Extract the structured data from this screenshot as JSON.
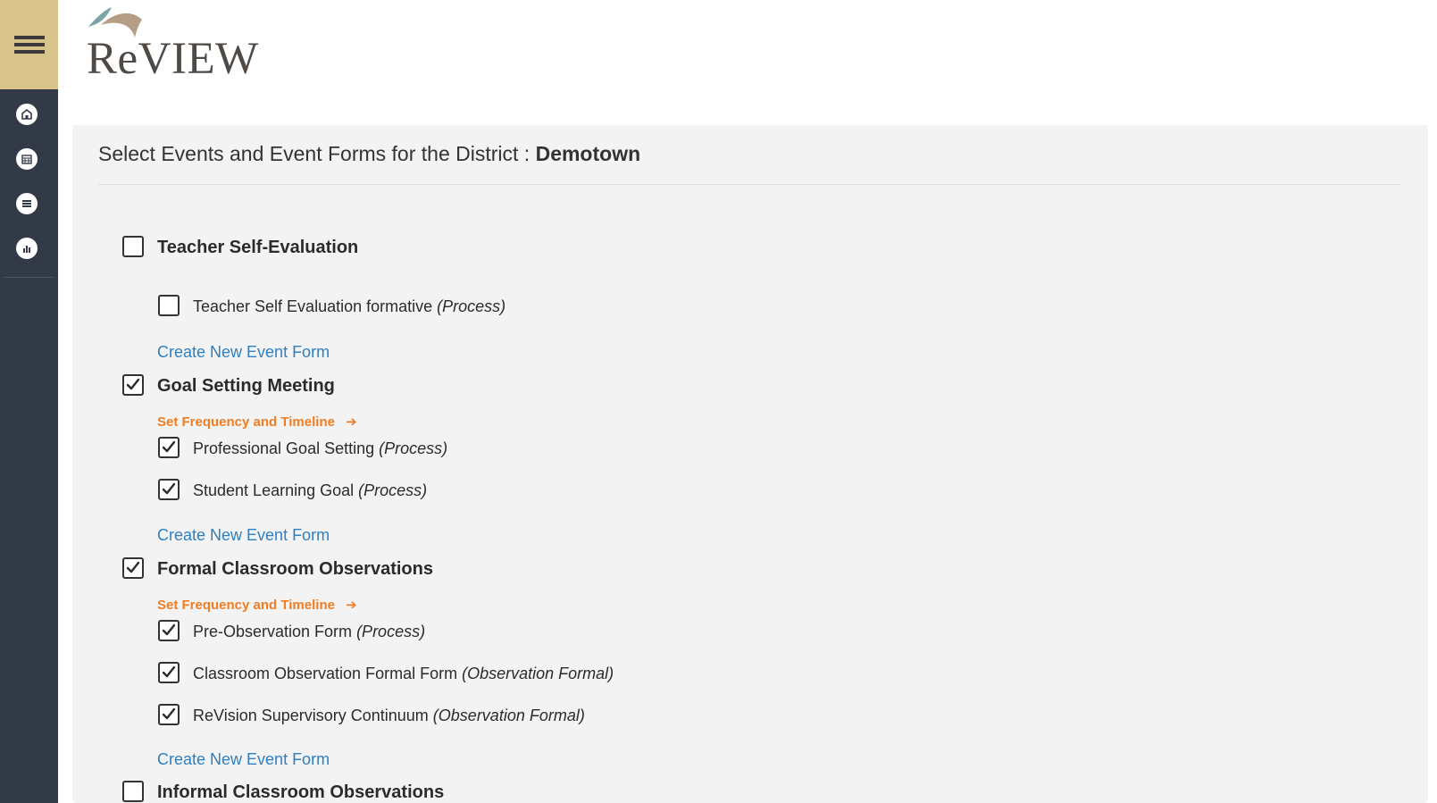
{
  "app": {
    "logo_text": "ReVIEW"
  },
  "sidebar": {
    "nav_items": [
      {
        "icon": "school-icon"
      },
      {
        "icon": "calendar-icon"
      },
      {
        "icon": "list-icon"
      },
      {
        "icon": "chart-icon"
      }
    ]
  },
  "page": {
    "title_prefix": "Select Events and Event Forms for the District : ",
    "district_name": "Demotown"
  },
  "events": [
    {
      "label": "Teacher Self-Evaluation",
      "checked": false,
      "frequency_link": "",
      "forms": [
        {
          "name": "Teacher Self Evaluation formative ",
          "type": "(Process)",
          "checked": false
        }
      ],
      "create_link": "Create New Event Form"
    },
    {
      "label": "Goal Setting Meeting",
      "checked": true,
      "frequency_link": "Set Frequency and Timeline",
      "forms": [
        {
          "name": "Professional Goal Setting ",
          "type": "(Process)",
          "checked": true
        },
        {
          "name": "Student Learning Goal ",
          "type": "(Process)",
          "checked": true
        }
      ],
      "create_link": "Create New Event Form"
    },
    {
      "label": "Formal Classroom Observations",
      "checked": true,
      "frequency_link": "Set Frequency and Timeline",
      "forms": [
        {
          "name": "Pre-Observation Form ",
          "type": "(Process)",
          "checked": true
        },
        {
          "name": "Classroom Observation Formal Form ",
          "type": "(Observation Formal)",
          "checked": true
        },
        {
          "name": "ReVision Supervisory Continuum ",
          "type": "(Observation Formal)",
          "checked": true
        }
      ],
      "create_link": "Create New Event Form"
    },
    {
      "label": "Informal Classroom Observations",
      "checked": false
    }
  ],
  "colors": {
    "sidebar": "#333a47",
    "menu_button": "#d8c38a",
    "link_blue": "#2f7fc1",
    "link_orange": "#f07d22"
  }
}
